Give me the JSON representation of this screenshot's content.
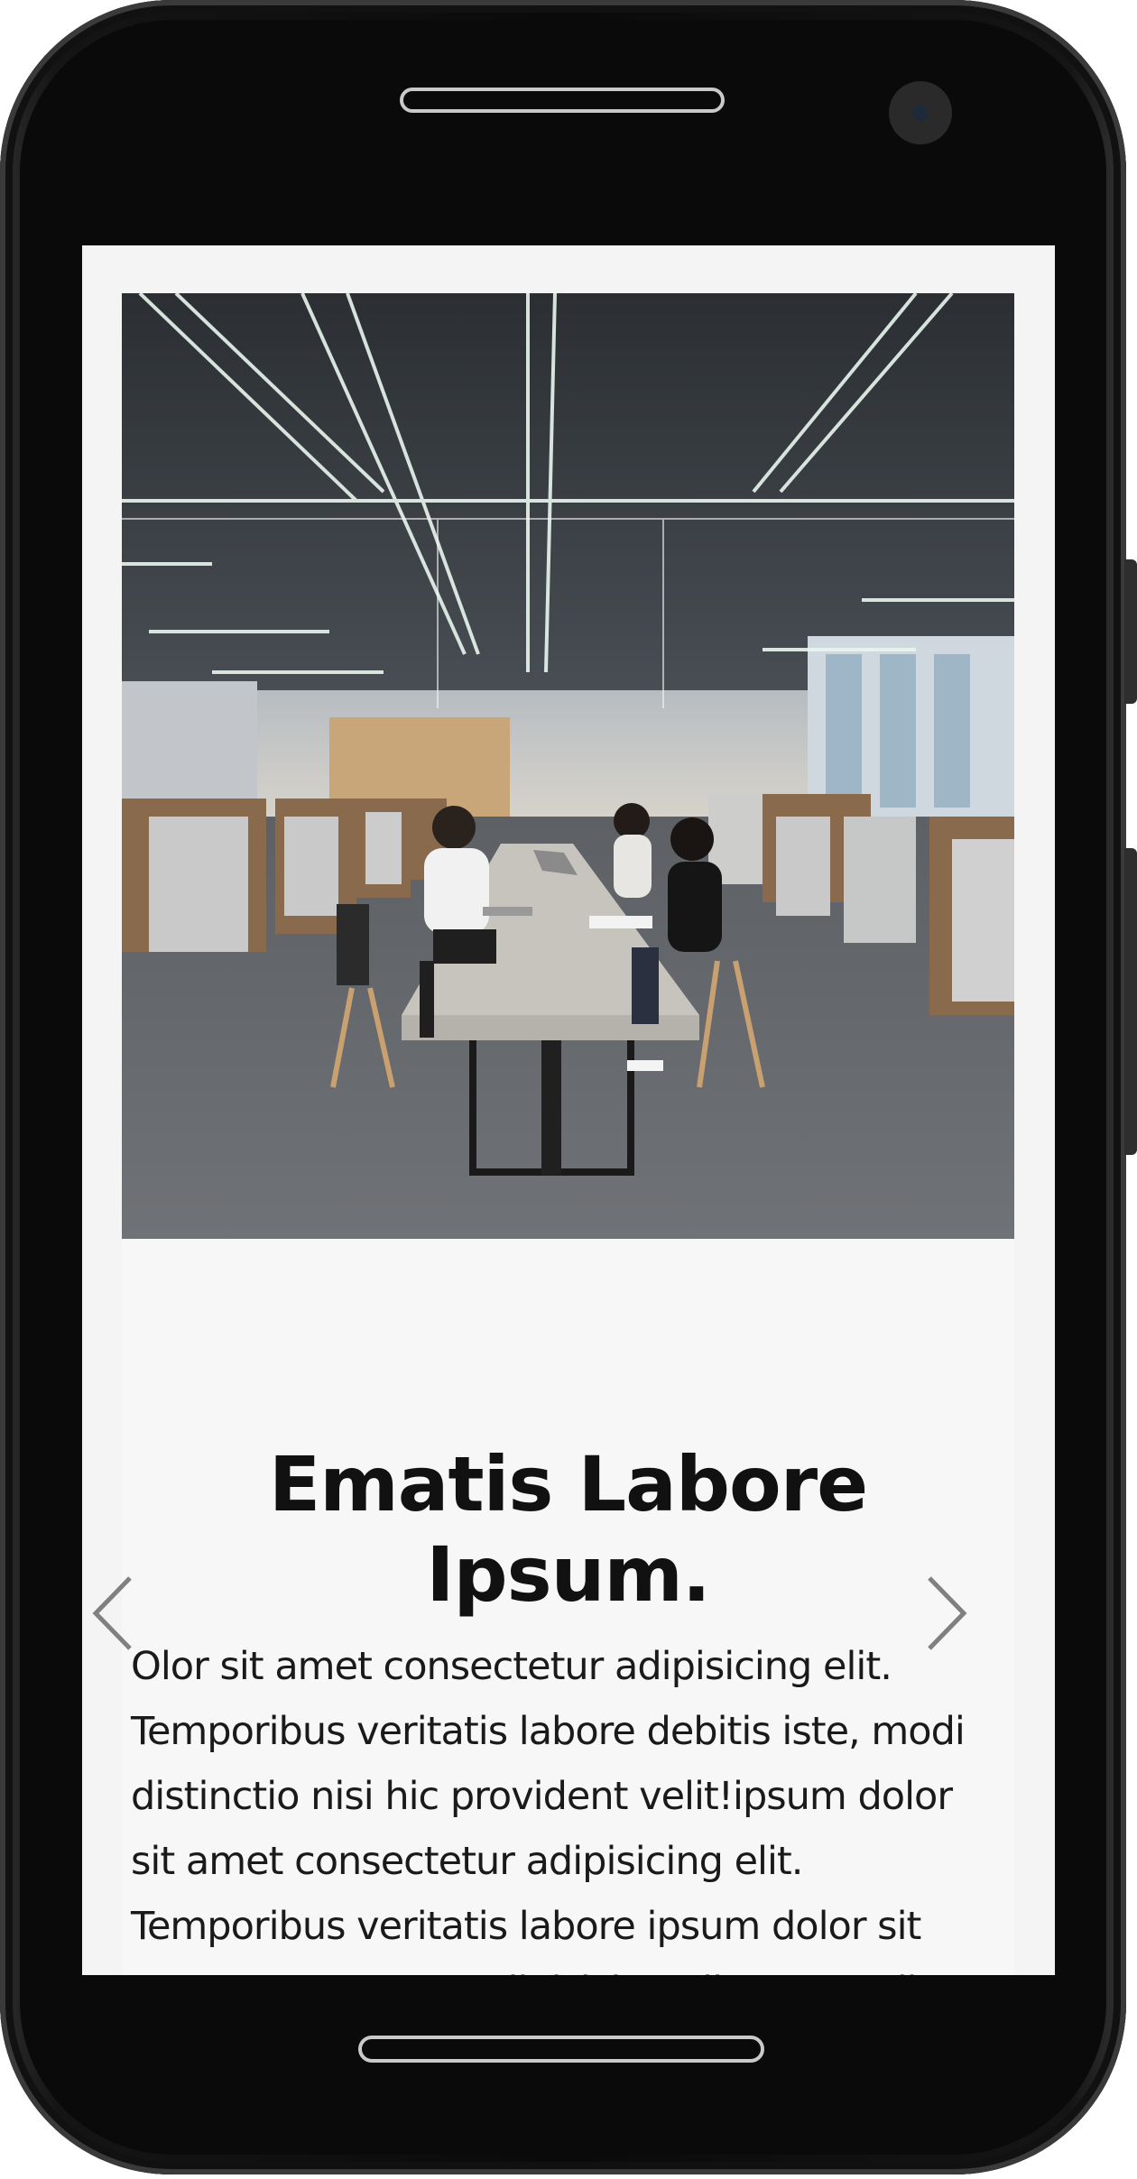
{
  "slide": {
    "headline": "Ematis Labore Ipsum.",
    "body": "Olor sit amet consectetur adipisicing elit. Temporibus veritatis labore debitis iste, modi distinctio nisi hic provident velit!ipsum dolor sit amet consectetur adipisicing elit. Temporibus veritatis labore ipsum dolor sit amet consectetur adipisicing elit. Temporibus"
  },
  "carousel": {
    "prev_icon": "chevron-left-icon",
    "next_icon": "chevron-right-icon"
  },
  "colors": {
    "device_frame": "#0a0a0a",
    "screen_background": "#f4f4f4",
    "card_background": "#f7f7f7",
    "headline": "#111111",
    "arrow": "#808080"
  }
}
